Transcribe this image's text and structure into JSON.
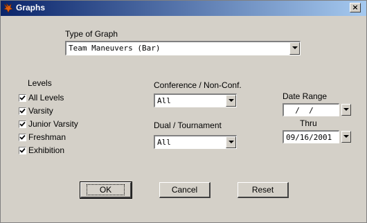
{
  "window": {
    "title": "Graphs",
    "close_label": "×"
  },
  "graph_type": {
    "label": "Type of Graph",
    "value": "Team Maneuvers (Bar)"
  },
  "levels": {
    "label": "Levels",
    "items": [
      {
        "label": "All Levels",
        "checked": true
      },
      {
        "label": "Varsity",
        "checked": true
      },
      {
        "label": "Junior Varsity",
        "checked": true
      },
      {
        "label": "Freshman",
        "checked": true
      },
      {
        "label": "Exhibition",
        "checked": true
      }
    ]
  },
  "conference": {
    "label": "Conference / Non-Conf.",
    "value": "All"
  },
  "dual": {
    "label": "Dual / Tournament",
    "value": "All"
  },
  "date_range": {
    "label": "Date Range",
    "from_value": "  /  /",
    "thru_label": "Thru",
    "thru_value": "09/16/2001"
  },
  "buttons": {
    "ok": "OK",
    "cancel": "Cancel",
    "reset": "Reset"
  }
}
